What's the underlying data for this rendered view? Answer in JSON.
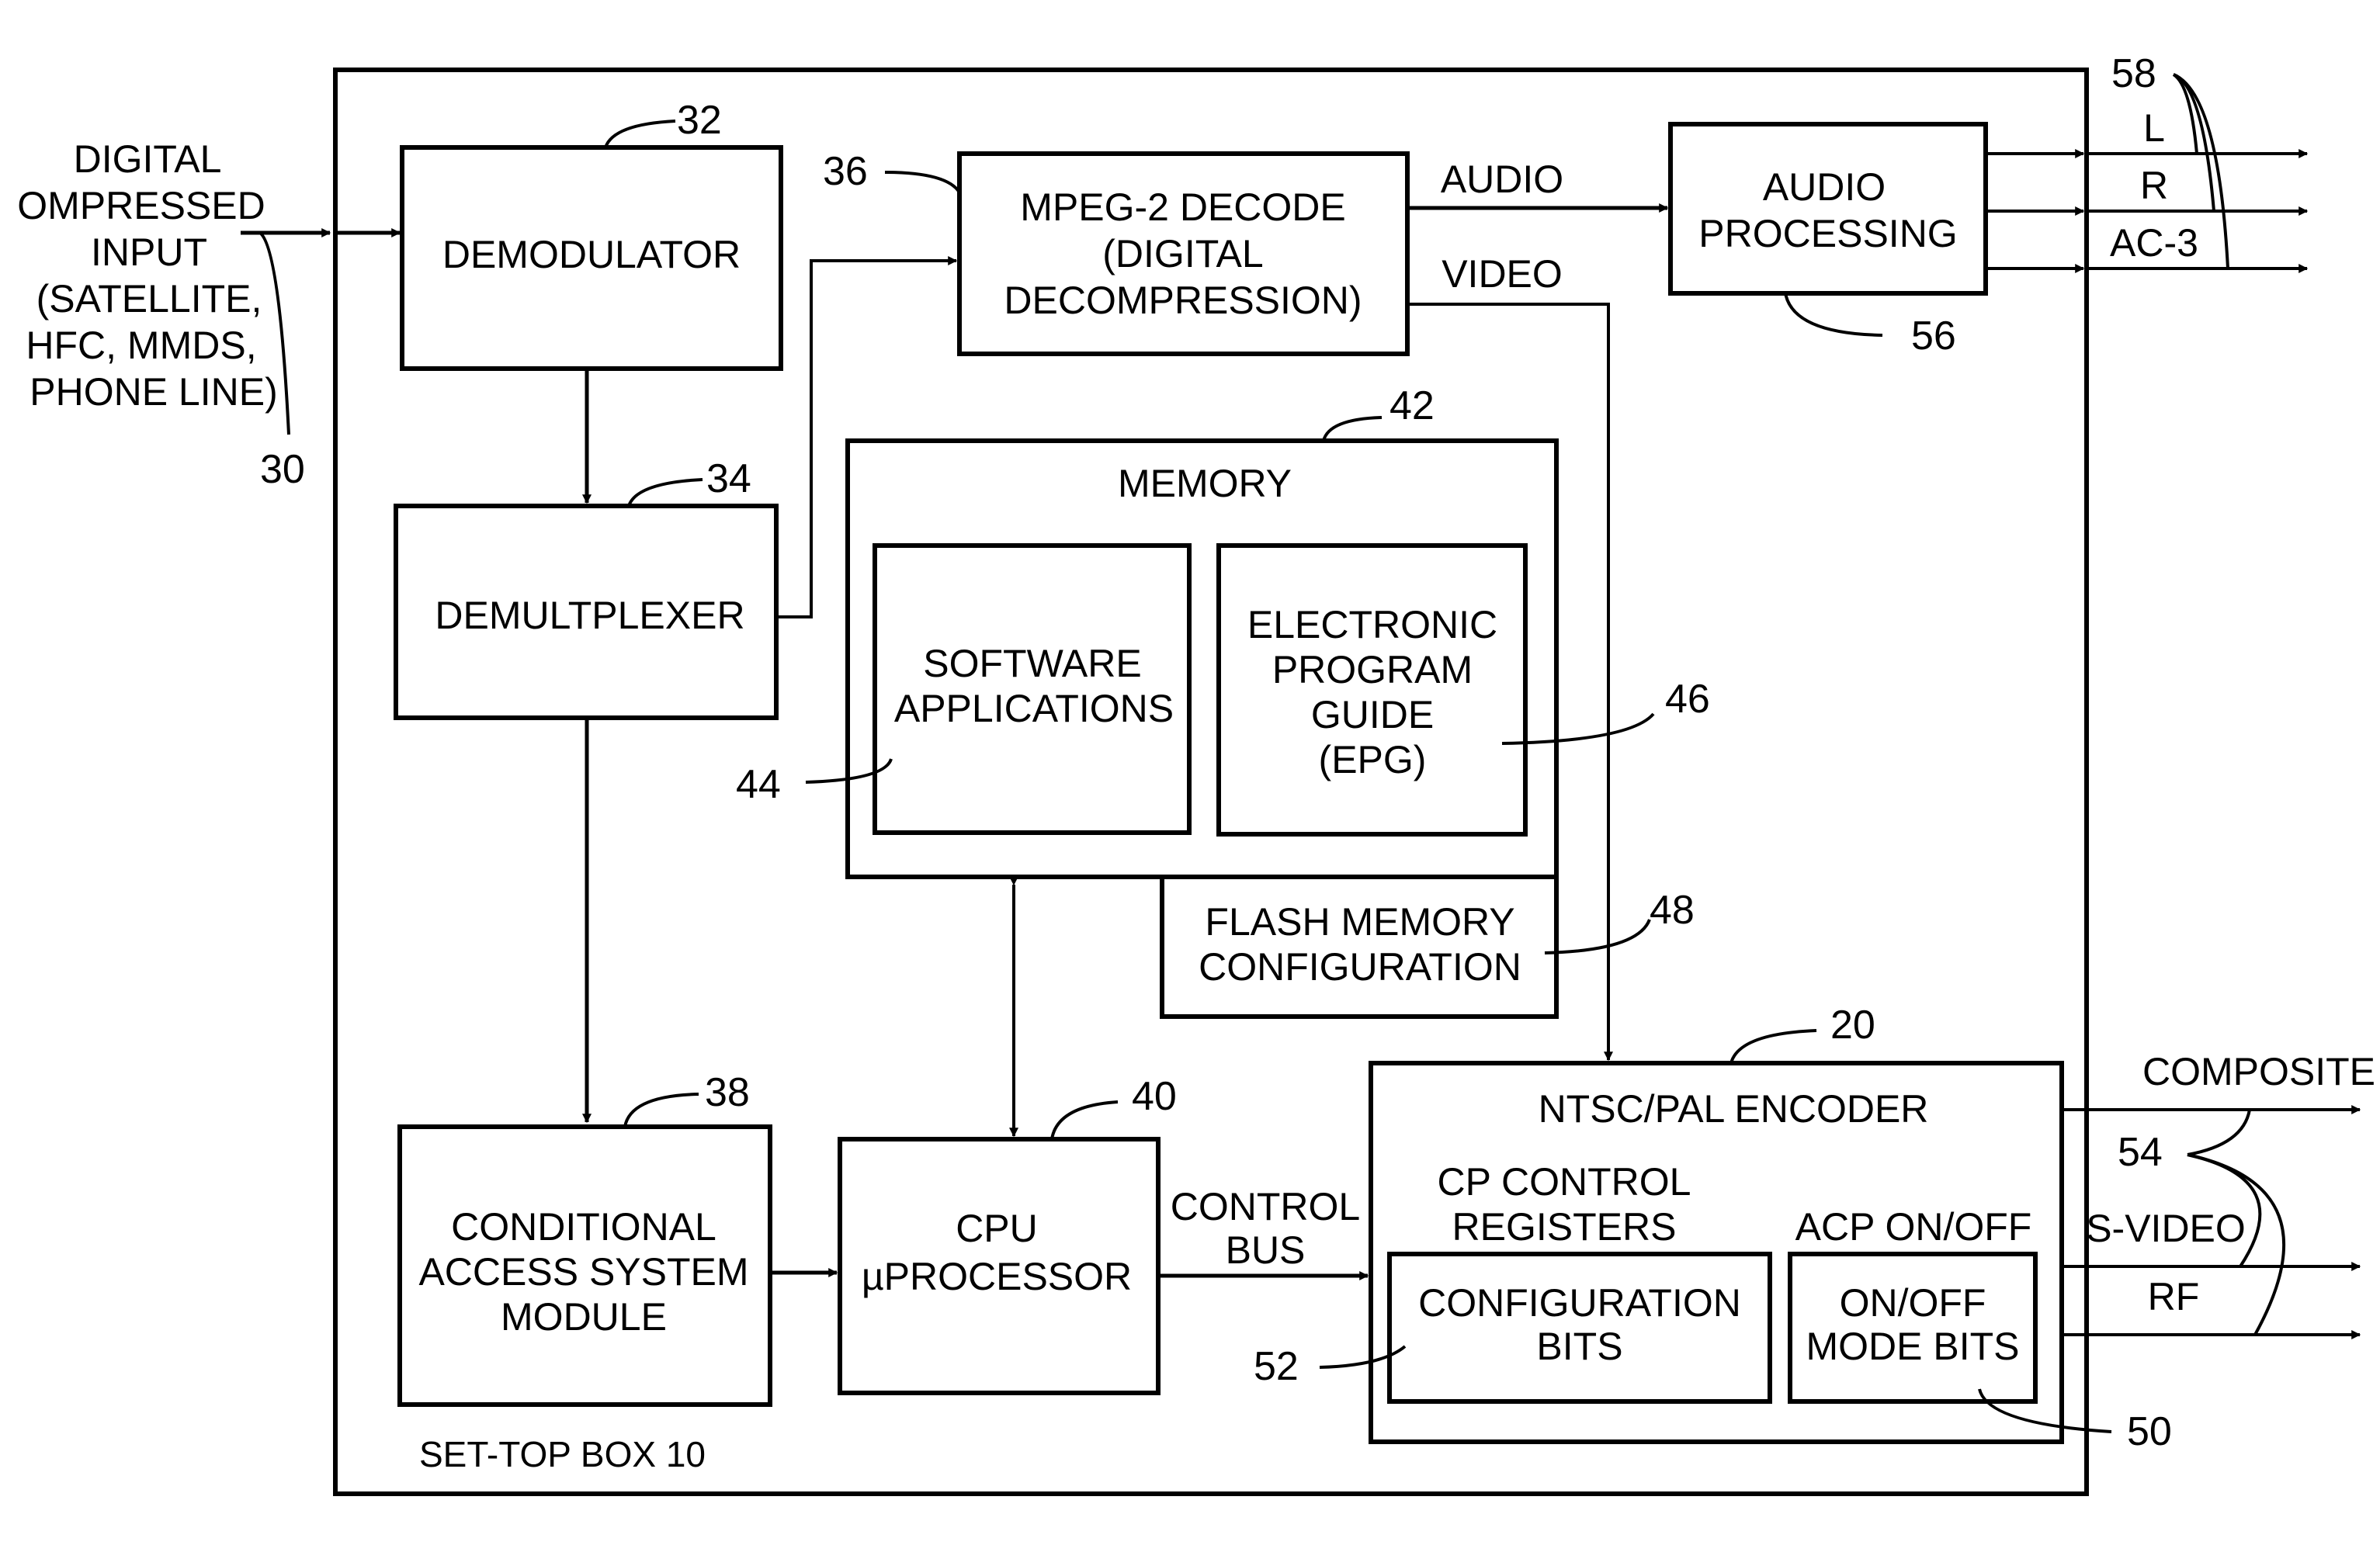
{
  "figure": {
    "title": "SET-TOP BOX 10",
    "input": {
      "lines": [
        "DIGITAL",
        "OMPRESSED",
        "INPUT",
        "(SATELLITE,",
        "HFC, MMDS,",
        "PHONE LINE)"
      ],
      "ref": "30"
    },
    "blocks": {
      "demodulator": {
        "lines": [
          "DEMODULATOR"
        ],
        "ref": "32"
      },
      "demultiplexer": {
        "lines": [
          "DEMULTPLEXER"
        ],
        "ref": "34"
      },
      "mpeg_decode": {
        "lines": [
          "MPEG-2 DECODE",
          "(DIGITAL",
          "DECOMPRESSION)"
        ],
        "ref": "36"
      },
      "conditional_access": {
        "lines": [
          "CONDITIONAL",
          "ACCESS SYSTEM",
          "MODULE"
        ],
        "ref": "38"
      },
      "cpu": {
        "lines": [
          "CPU",
          "µPROCESSOR"
        ],
        "ref": "40"
      },
      "memory": {
        "lines": [
          "MEMORY"
        ],
        "ref": "42"
      },
      "software_applications": {
        "lines": [
          "SOFTWARE",
          "APPLICATIONS"
        ],
        "ref": "44"
      },
      "epg": {
        "lines": [
          "ELECTRONIC",
          "PROGRAM",
          "GUIDE",
          "(EPG)"
        ],
        "ref": "46"
      },
      "flash_memory": {
        "lines": [
          "FLASH MEMORY",
          "CONFIGURATION"
        ],
        "ref": "48"
      },
      "encoder": {
        "lines": [
          "NTSC/PAL ENCODER"
        ],
        "ref": "20"
      },
      "cp_control_registers": {
        "lines": [
          "CP CONTROL",
          "REGISTERS"
        ]
      },
      "configuration_bits": {
        "lines": [
          "CONFIGURATION",
          "BITS"
        ],
        "ref": "52"
      },
      "acp_on_off": {
        "lines": [
          "ACP ON/OFF"
        ]
      },
      "on_off_mode_bits": {
        "lines": [
          "ON/OFF",
          "MODE BITS"
        ],
        "ref": "50"
      },
      "audio_processing": {
        "lines": [
          "AUDIO",
          "PROCESSING"
        ],
        "ref": "56"
      }
    },
    "signals": {
      "audio": "AUDIO",
      "video": "VIDEO",
      "control_bus": [
        "CONTROL",
        "BUS"
      ]
    },
    "audio_outputs": {
      "labels": [
        "L",
        "R",
        "AC-3"
      ],
      "ref": "58"
    },
    "video_outputs": {
      "labels": [
        "COMPOSITE",
        "S-VIDEO",
        "RF"
      ],
      "ref": "54"
    }
  }
}
